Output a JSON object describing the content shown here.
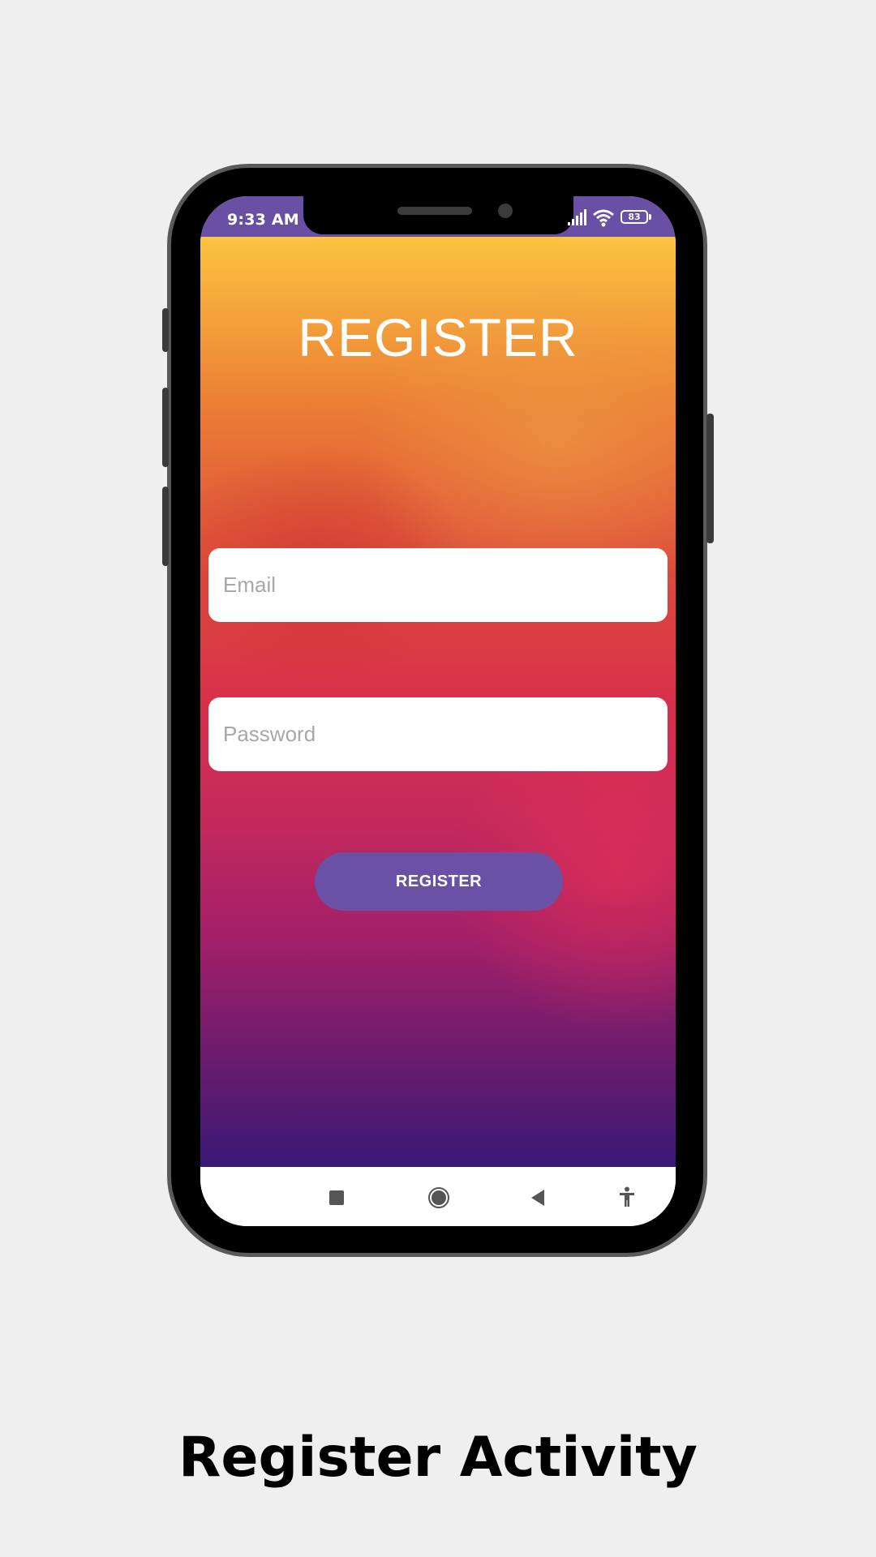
{
  "status_bar": {
    "time": "9:33 AM",
    "battery": "83",
    "icons": [
      "signal-icon",
      "wifi-icon",
      "battery-icon"
    ],
    "color": "#6a50a4"
  },
  "app": {
    "title": "REGISTER",
    "email": {
      "value": "",
      "placeholder": "Email"
    },
    "password": {
      "value": "",
      "placeholder": "Password"
    },
    "register_button": "REGISTER",
    "accent_color": "#6a51a5"
  },
  "nav_bar": {
    "icons": [
      "recents-square-icon",
      "home-circle-icon",
      "back-triangle-icon",
      "accessibility-icon"
    ]
  },
  "caption": "Register Activity"
}
